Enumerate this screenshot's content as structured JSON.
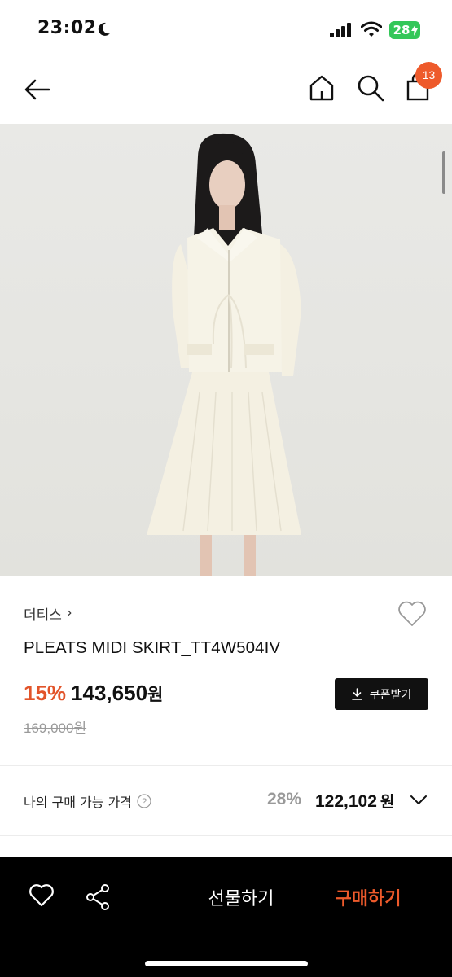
{
  "status_bar": {
    "time": "23:02",
    "battery": "28"
  },
  "nav": {
    "cart_count": "13"
  },
  "product": {
    "brand": "더티스",
    "brand_chevron": "›",
    "title": "PLEATS MIDI SKIRT_TT4W504IV",
    "discount_rate": "15%",
    "sale_price": "143,650",
    "sale_unit": "원",
    "original_price": "169,000원",
    "coupon_label": "쿠폰받기"
  },
  "my_price": {
    "label": "나의 구매 가능 가격",
    "rate": "28%",
    "value": "122,102",
    "unit": "원"
  },
  "bottom_bar": {
    "gift_label": "선물하기",
    "buy_label": "구매하기"
  },
  "colors": {
    "accent": "#ee5a2b",
    "discount": "#e2542a",
    "battery": "#34c759"
  },
  "icons": [
    "moon-icon",
    "signal-icon",
    "wifi-icon",
    "back-arrow-icon",
    "home-icon",
    "search-icon",
    "shopping-bag-icon",
    "heart-icon",
    "download-icon",
    "info-icon",
    "chevron-down-icon",
    "share-icon"
  ]
}
